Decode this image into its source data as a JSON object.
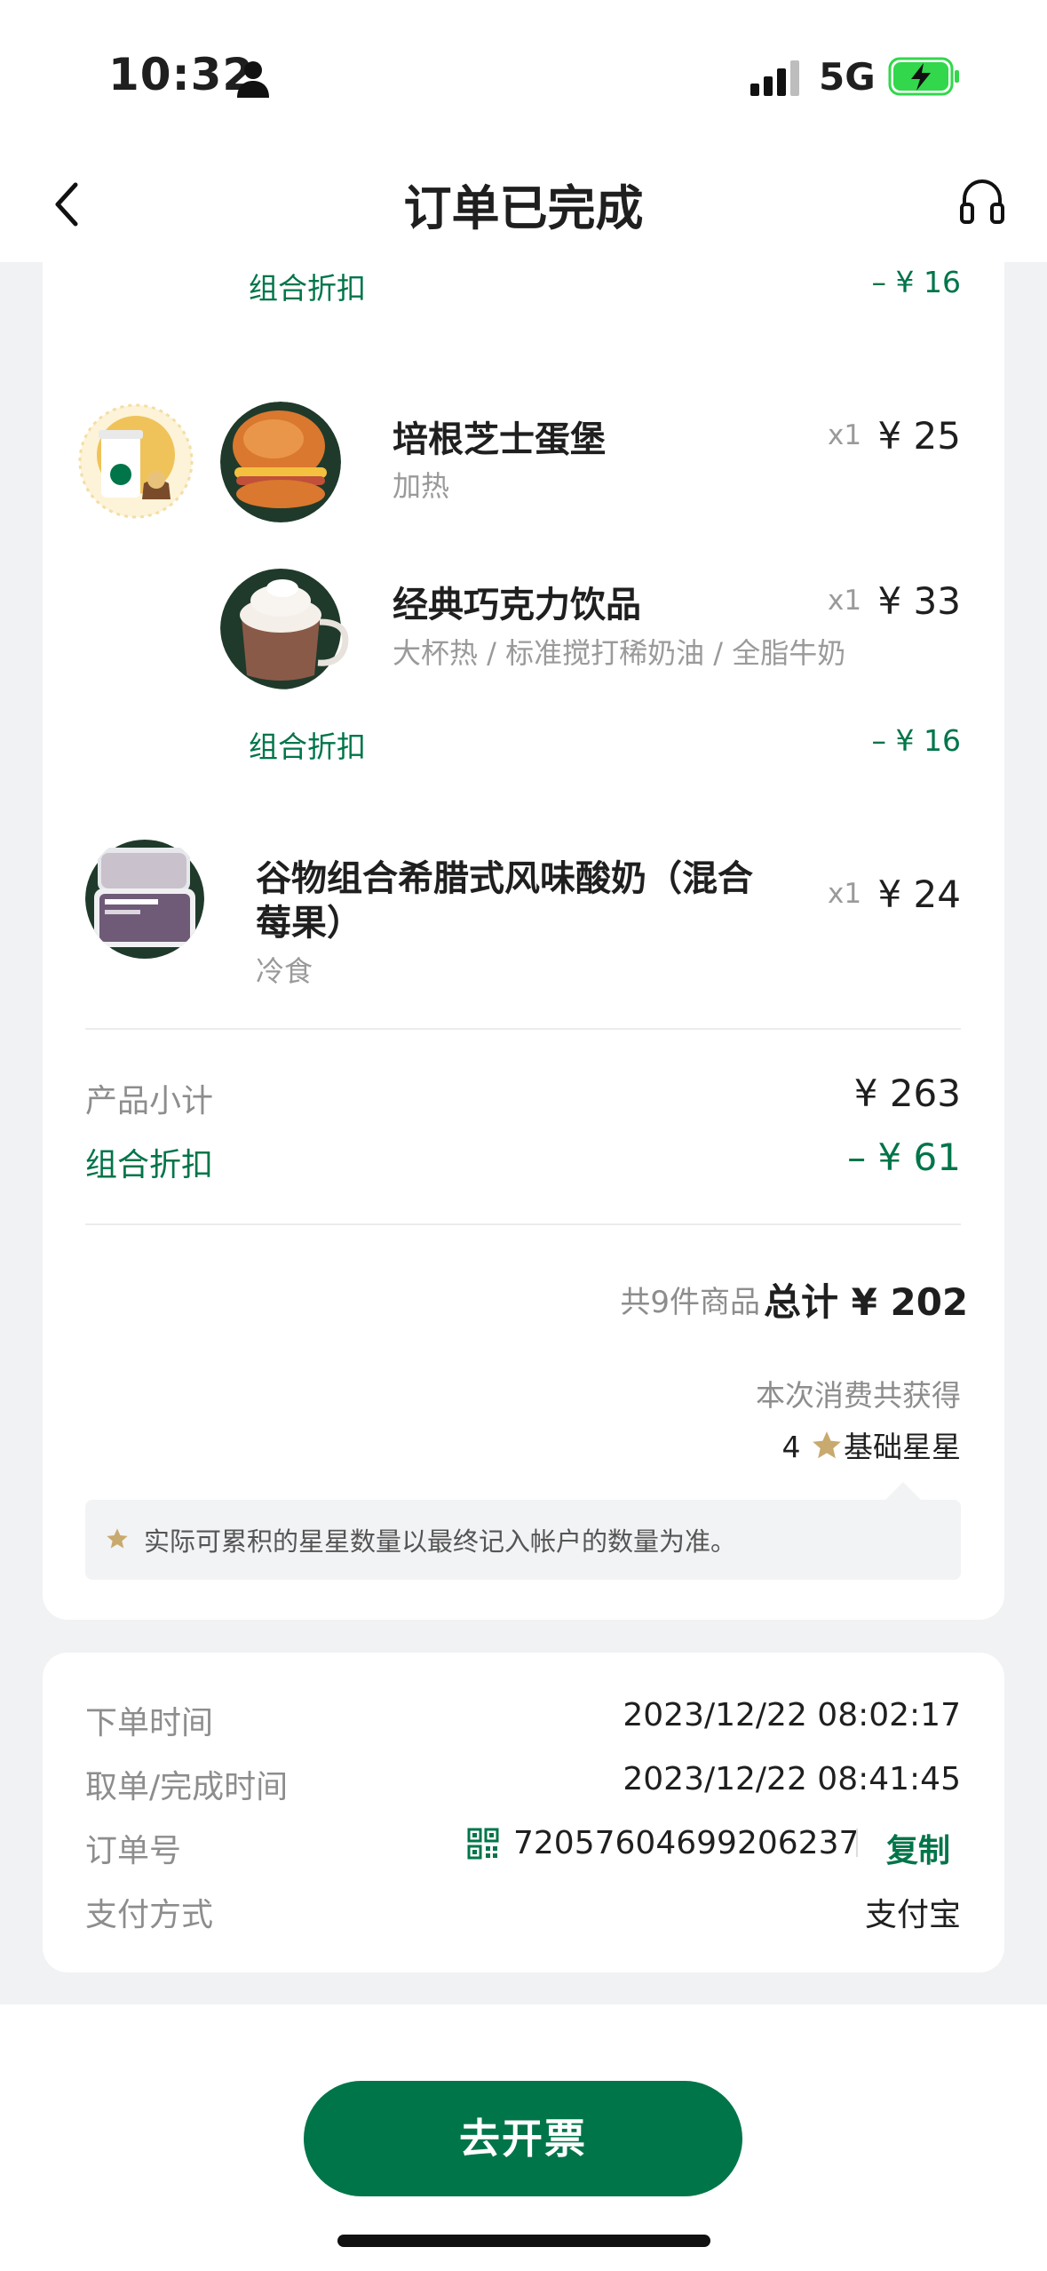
{
  "status_bar": {
    "time": "10:32",
    "network": "5G"
  },
  "header": {
    "title": "订单已完成"
  },
  "order_items": {
    "group1_discount": {
      "label": "组合折扣",
      "amount": "– ¥ 16"
    },
    "item_sandwich": {
      "name": "培根芝士蛋堡",
      "options": "加热",
      "qty": "x1",
      "price": "¥ 25"
    },
    "item_chocolate": {
      "name": "经典巧克力饮品",
      "options": "大杯热 / 标准搅打稀奶油 / 全脂牛奶",
      "qty": "x1",
      "price": "¥ 33"
    },
    "group2_discount": {
      "label": "组合折扣",
      "amount": "– ¥ 16"
    },
    "item_yogurt": {
      "name_line1": "谷物组合希腊式风味酸奶（混合",
      "name_line2": "莓果）",
      "options": "冷食",
      "qty": "x1",
      "price": "¥ 24"
    }
  },
  "summary": {
    "subtotal_label": "产品小计",
    "subtotal_value": "¥ 263",
    "discount_label": "组合折扣",
    "discount_value": "– ¥ 61",
    "count_text": "共9件商品",
    "total_text": "总计 ¥ 202",
    "stars_title": "本次消费共获得",
    "stars_count": "4",
    "stars_label": "基础星星",
    "stars_note": "实际可累积的星星数量以最终记入帐户的数量为准。"
  },
  "order_info": {
    "order_time_label": "下单时间",
    "order_time_value": "2023/12/22 08:02:17",
    "complete_time_label": "取单/完成时间",
    "complete_time_value": "2023/12/22 08:41:45",
    "order_no_label": "订单号",
    "order_no_value": "72057604699206237",
    "copy_label": "复制",
    "payment_label": "支付方式",
    "payment_value": "支付宝"
  },
  "actions": {
    "invoice_button": "去开票"
  },
  "colors": {
    "brand_green": "#00754a",
    "star_gold": "#c8a96e",
    "battery_green": "#32d74b"
  },
  "icons": [
    "person-icon",
    "signal-icon",
    "battery-charging-icon",
    "back-arrow-icon",
    "headset-icon",
    "qr-code-icon",
    "star-icon"
  ]
}
